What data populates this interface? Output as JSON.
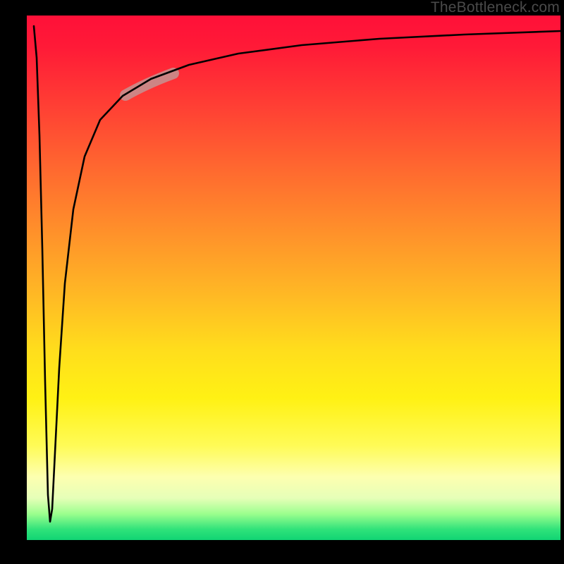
{
  "watermark": "TheBottleneck.com",
  "chart_data": {
    "type": "line",
    "title": "",
    "xlabel": "",
    "ylabel": "",
    "xlim": [
      0,
      100
    ],
    "ylim": [
      0,
      100
    ],
    "grid": false,
    "legend": false,
    "series": [
      {
        "name": "bottleneck-curve",
        "x": [
          0,
          2,
          3,
          4,
          5,
          6,
          8,
          10,
          14,
          18,
          22,
          28,
          35,
          45,
          60,
          80,
          100
        ],
        "values": [
          98,
          60,
          30,
          5,
          30,
          49,
          64,
          73,
          81,
          85,
          87,
          90,
          92,
          94,
          95,
          96,
          97
        ]
      }
    ],
    "annotation": {
      "name": "highlight-segment",
      "x_range": [
        18,
        27
      ],
      "value_range": [
        84,
        89
      ]
    }
  }
}
